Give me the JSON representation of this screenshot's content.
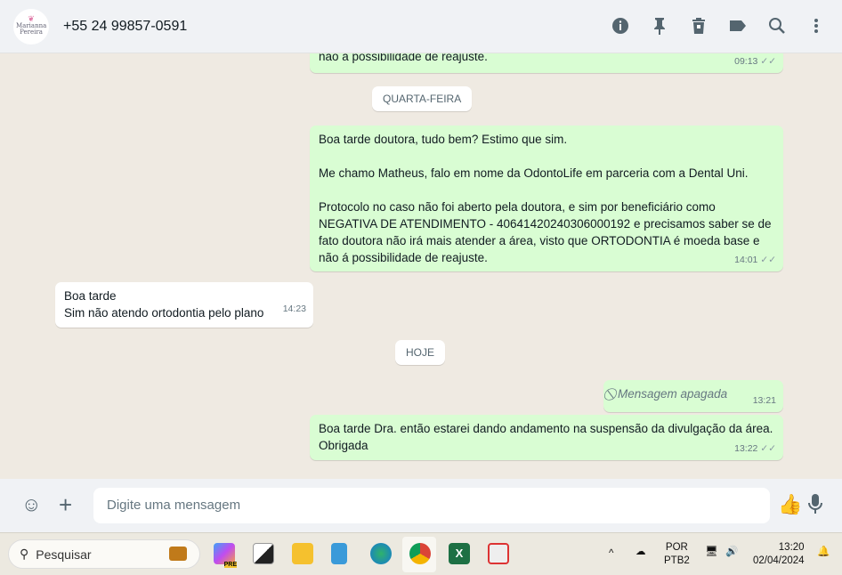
{
  "header": {
    "contact": "+55 24 99857-0591",
    "avatar_text": "Marianna Pereira",
    "icons": [
      "info-icon",
      "pin-icon",
      "delete-icon",
      "label-icon",
      "search-icon",
      "menu-icon"
    ]
  },
  "chat": {
    "m0": {
      "text": "não á possibilidade de reajuste.",
      "time": "09:13"
    },
    "date1": "QUARTA-FEIRA",
    "m1": {
      "p1": "Boa tarde doutora, tudo bem? Estimo que sim.",
      "p2": "Me chamo Matheus, falo em nome da OdontoLife em parceria com a Dental Uni.",
      "p3": "Protocolo no caso não foi aberto pela doutora, e sim por beneficiário como NEGATIVA DE ATENDIMENTO - 40641420240306000192 e precisamos saber se de fato doutora não irá mais atender a área, visto que ORTODONTIA é moeda base e não á possibilidade de reajuste.",
      "time": "14:01"
    },
    "m2": {
      "l1": "Boa tarde",
      "l2": "Sim não atendo ortodontia pelo plano",
      "time": "14:23"
    },
    "date2": "HOJE",
    "m3": {
      "text": "Mensagem apagada",
      "time": "13:21"
    },
    "m4": {
      "text": "Boa tarde Dra. então estarei dando andamento na suspensão da divulgação da área. Obrigada",
      "time": "13:22"
    }
  },
  "composer": {
    "placeholder": "Digite uma mensagem"
  },
  "taskbar": {
    "search": "Pesquisar",
    "lang1": "POR",
    "lang2": "PTB2",
    "time": "13:20",
    "date": "02/04/2024",
    "copilot_badge": "PRE"
  }
}
